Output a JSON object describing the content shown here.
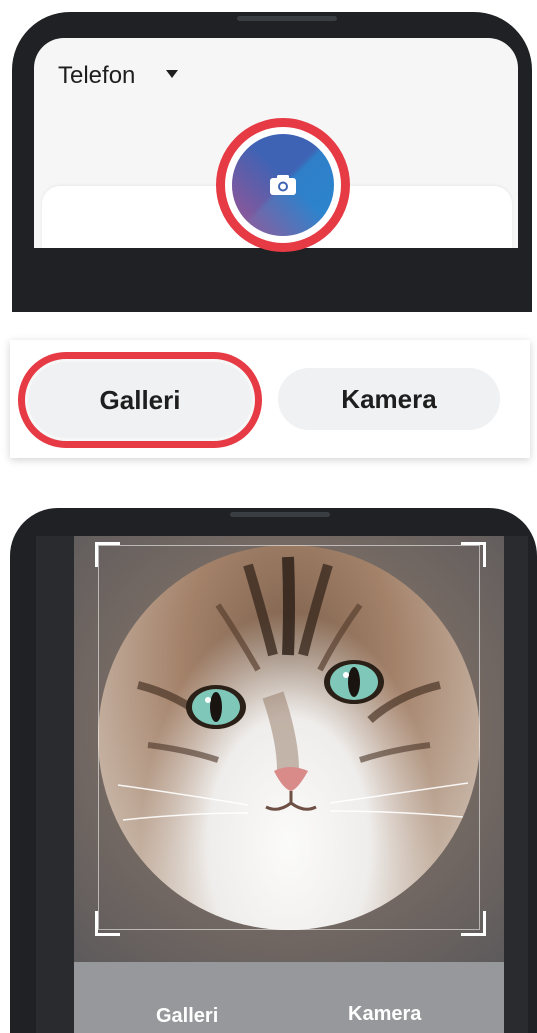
{
  "top_screen": {
    "account_label": "Telefon"
  },
  "button_strip": {
    "gallery_label": "Galleri",
    "camera_label": "Kamera"
  },
  "crop_screen": {
    "gallery_label": "Galleri",
    "camera_label": "Kamera"
  },
  "colors": {
    "highlight": "#e63a45",
    "avatar_blue": "#2f7fc8",
    "avatar_purple": "#b2508c",
    "button_bg": "#f0f1f2",
    "phone_frame": "#1f2124"
  },
  "icons": [
    "caret-down-icon",
    "camera-icon"
  ]
}
